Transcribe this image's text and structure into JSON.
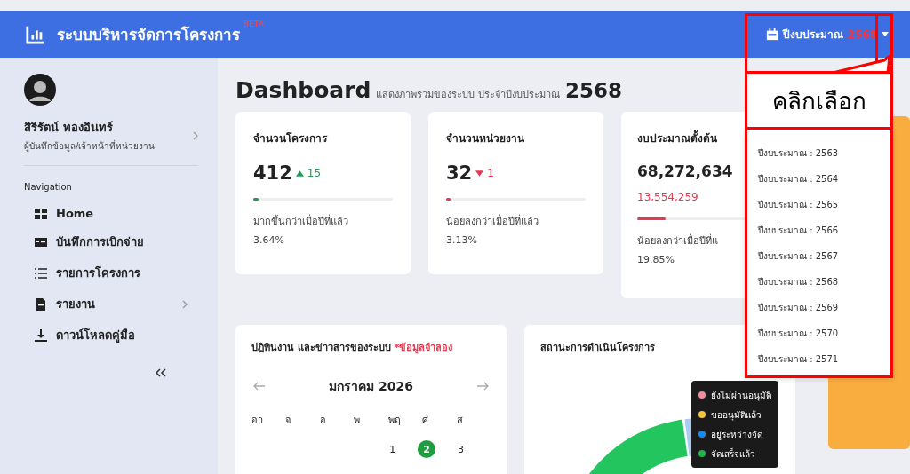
{
  "header": {
    "title": "ระบบบริหารจัดการโครงการ",
    "badge": "BETA",
    "year_selector": {
      "label": "ปีงบประมาณ",
      "year": "2568"
    }
  },
  "sidebar": {
    "user": {
      "name": "สิริรัตน์ ทองอินทร์",
      "role": "ผู้บันทึกข้อมูล/เจ้าหน้าที่หน่วยงาน"
    },
    "section": "Navigation",
    "items": [
      {
        "label": "Home",
        "kind": "grid",
        "has_submenu": false
      },
      {
        "label": "บันทึกการเบิกจ่าย",
        "kind": "card",
        "has_submenu": false
      },
      {
        "label": "รายการโครงการ",
        "kind": "list",
        "has_submenu": false
      },
      {
        "label": "รายงาน",
        "kind": "document",
        "has_submenu": true
      },
      {
        "label": "ดาวน์โหลดคู่มือ",
        "kind": "download",
        "has_submenu": false
      }
    ]
  },
  "page": {
    "title": "Dashboard",
    "subtitle": "แสดงภาพรวมของระบบ ประจำปีงบประมาณ",
    "year": "2568"
  },
  "stats": [
    {
      "title": "จำนวนโครงการ",
      "value": "412",
      "kind": "increase",
      "change": "15",
      "level": 0.04,
      "note": "มากขึ้นกว่าเมื่อปีที่แล้ว",
      "percent": "3.64%"
    },
    {
      "title": "จำนวนหน่วยงาน",
      "value": "32",
      "kind": "decrease",
      "change": "1",
      "level": 0.03,
      "note": "น้อยลงกว่าเมื่อปีที่แล้ว",
      "percent": "3.13%"
    },
    {
      "title": "งบประมาณตั้งต้น",
      "value": "68,272,634",
      "kind": "decrease",
      "sub_value": "13,554,259",
      "level": 0.2,
      "note": "น้อยลงกว่าเมื่อปีที่แ",
      "percent": "19.85%"
    }
  ],
  "calendar": {
    "title": "ปฏิทินงาน และข่าวสารของระบบ",
    "note": "*ข้อมูลจำลอง",
    "month": "มกราคม 2026",
    "weekdays": [
      "อา",
      "จ",
      "อ",
      "พ",
      "พฤ",
      "ศ",
      "ส"
    ],
    "week": [
      {
        "kind": "blank"
      },
      {
        "kind": "blank"
      },
      {
        "kind": "blank"
      },
      {
        "kind": "blank"
      },
      {
        "kind": "day",
        "label": "1",
        "selected": false
      },
      {
        "kind": "day",
        "label": "2",
        "selected": true
      },
      {
        "kind": "day",
        "label": "3",
        "selected": false
      }
    ]
  },
  "status": {
    "title": "สถานะการดำเนินโครงการ",
    "legend": [
      {
        "label": "ยังไม่ผ่านอนุมัติ",
        "color": "#f28b9b"
      },
      {
        "label": "ขออนุมัติแล้ว",
        "color": "#f5c542"
      },
      {
        "label": "อยู่ระหว่างจัด",
        "color": "#1e88e5"
      },
      {
        "label": "จัดเสร็จแล้ว",
        "color": "#22b14c"
      }
    ]
  },
  "year_dropdown": {
    "options": [
      "ปีงบประมาณ : 2563",
      "ปีงบประมาณ : 2564",
      "ปีงบประมาณ : 2565",
      "ปีงบประมาณ : 2566",
      "ปีงบประมาณ : 2567",
      "ปีงบประมาณ : 2568",
      "ปีงบประมาณ : 2569",
      "ปีงบประมาณ : 2570",
      "ปีงบประมาณ : 2571"
    ]
  },
  "annotation": {
    "callout": "คลิกเลือก"
  }
}
